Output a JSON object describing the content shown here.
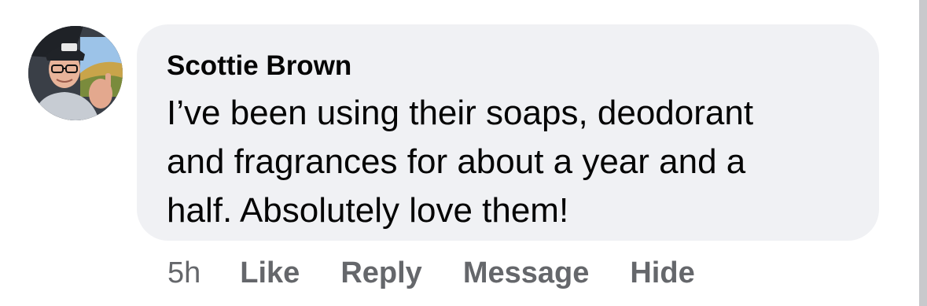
{
  "comment": {
    "author": "Scottie Brown",
    "text": "I’ve been using their soaps, deodorant\nand fragrances for about a year and a\nhalf. Absolutely love them!",
    "avatar_icon": "profile-photo"
  },
  "actions": {
    "time": "5h",
    "like": "Like",
    "reply": "Reply",
    "message": "Message",
    "hide": "Hide"
  },
  "colors": {
    "bubble": "#f0f1f4",
    "text": "#050505",
    "secondary": "#65676b"
  }
}
